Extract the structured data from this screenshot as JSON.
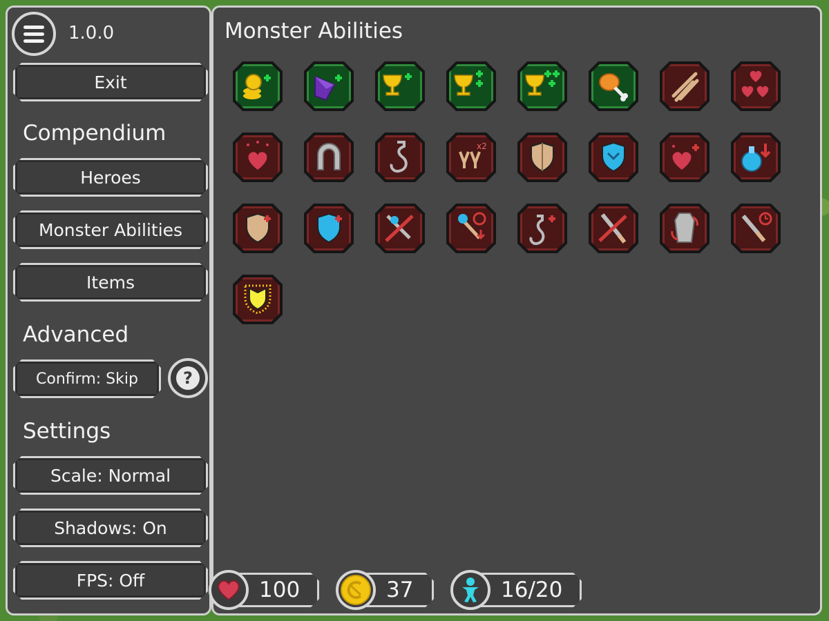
{
  "sidebar": {
    "version": "1.0.0",
    "exit_label": "Exit",
    "compendium_heading": "Compendium",
    "heroes_label": "Heroes",
    "monster_abilities_label": "Monster Abilities",
    "items_label": "Items",
    "advanced_heading": "Advanced",
    "confirm_label": "Confirm: Skip",
    "help_label": "?",
    "settings_heading": "Settings",
    "scale_label": "Scale: Normal",
    "shadows_label": "Shadows: On",
    "fps_label": "FPS: Off"
  },
  "main": {
    "title": "Monster Abilities",
    "abilities": [
      {
        "name": "gold-bonus-icon",
        "frame": "green"
      },
      {
        "name": "gem-bonus-icon",
        "frame": "green"
      },
      {
        "name": "goblet-bonus-icon",
        "frame": "green"
      },
      {
        "name": "goblet-double-bonus-icon",
        "frame": "green"
      },
      {
        "name": "goblet-triple-bonus-icon",
        "frame": "green"
      },
      {
        "name": "drumstick-icon",
        "frame": "green"
      },
      {
        "name": "slash-icon",
        "frame": "red"
      },
      {
        "name": "triple-hearts-icon",
        "frame": "red"
      },
      {
        "name": "sparkle-heart-icon",
        "frame": "red"
      },
      {
        "name": "magnet-icon",
        "frame": "red"
      },
      {
        "name": "hook-icon",
        "frame": "red"
      },
      {
        "name": "double-claw-icon",
        "frame": "red"
      },
      {
        "name": "armor-shield-icon",
        "frame": "red"
      },
      {
        "name": "blue-shield-icon",
        "frame": "red"
      },
      {
        "name": "heart-plus-icon",
        "frame": "red"
      },
      {
        "name": "potion-down-icon",
        "frame": "red"
      },
      {
        "name": "armor-plus-icon",
        "frame": "red"
      },
      {
        "name": "blue-shield-plus-icon",
        "frame": "red"
      },
      {
        "name": "no-magic-sword-icon",
        "frame": "red"
      },
      {
        "name": "magic-wand-timer-icon",
        "frame": "red"
      },
      {
        "name": "hook-plus-icon",
        "frame": "red"
      },
      {
        "name": "no-dagger-icon",
        "frame": "red"
      },
      {
        "name": "coffin-revive-icon",
        "frame": "red"
      },
      {
        "name": "dagger-timer-icon",
        "frame": "red"
      },
      {
        "name": "radiant-shield-icon",
        "frame": "red"
      }
    ]
  },
  "stats": {
    "health": "100",
    "gold": "37",
    "heroes": "16/20"
  },
  "colors": {
    "panel": "#464646",
    "border": "#cfcfcf",
    "green_frame": "#0f4d1d",
    "red_frame": "#4a1616",
    "heart": "#d43c52",
    "coin": "#f2c511",
    "hero_figure": "#35d6e6"
  }
}
